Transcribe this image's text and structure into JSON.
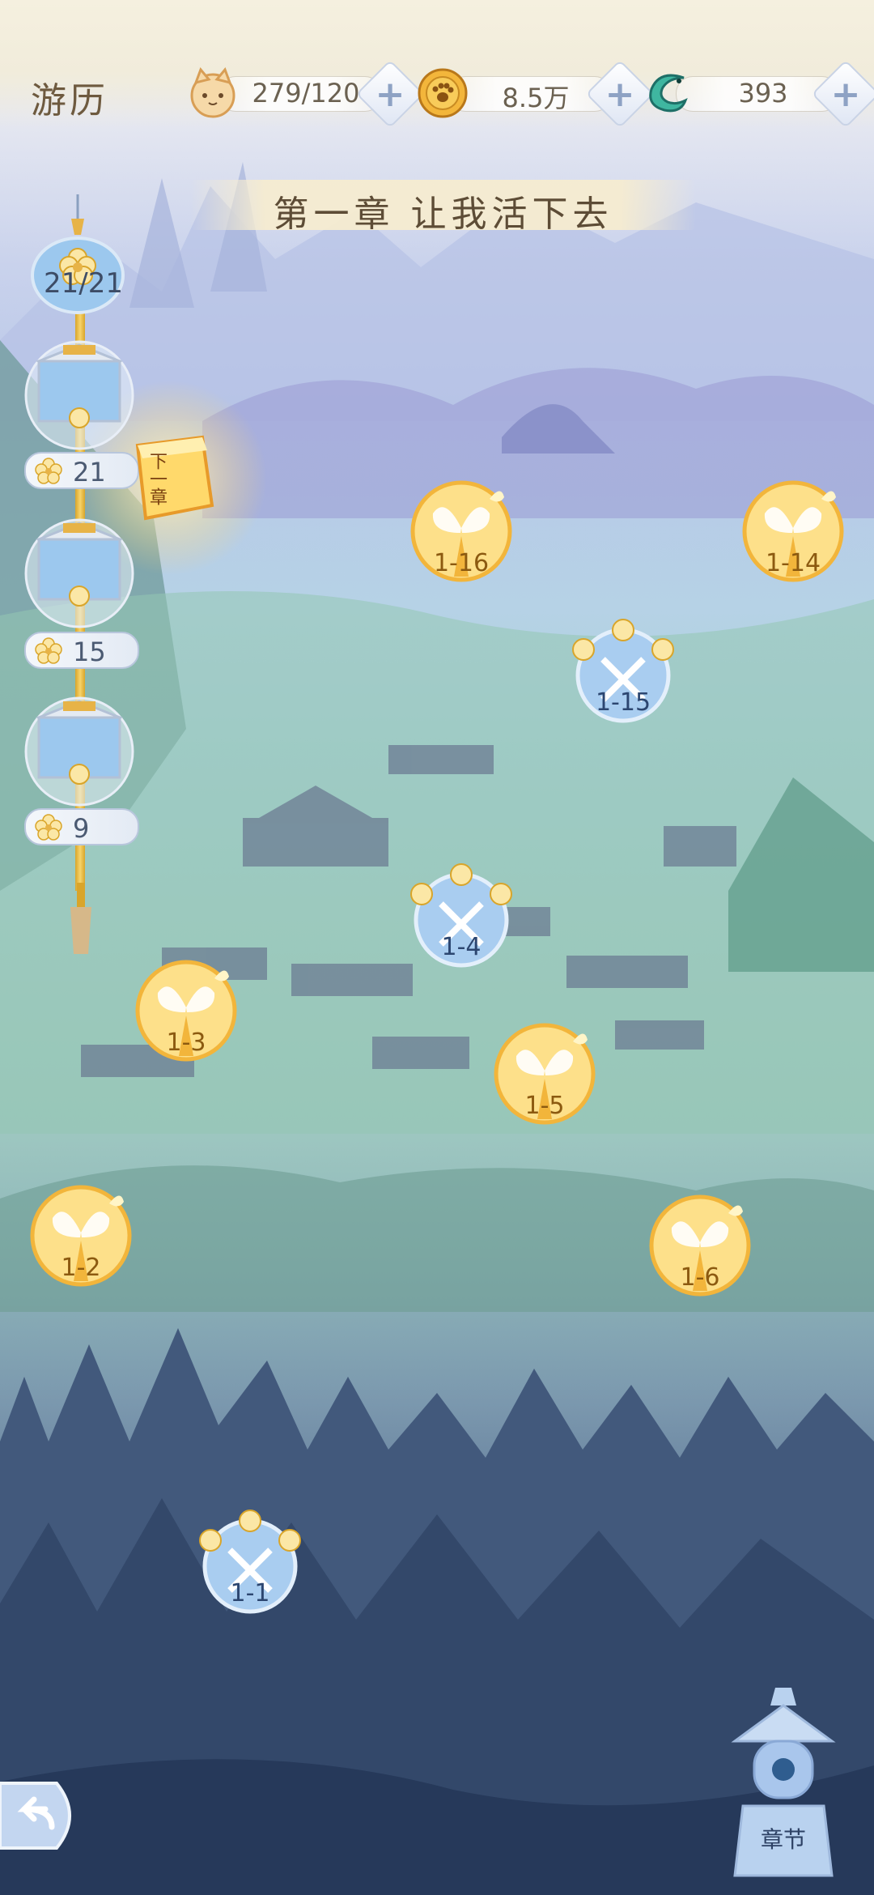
{
  "header": {
    "title": "游历",
    "resources": [
      {
        "icon": "cat-face-icon",
        "value": "279/120"
      },
      {
        "icon": "paw-coin-icon",
        "value": "8.5万"
      },
      {
        "icon": "jade-dragon-icon",
        "value": "393"
      }
    ]
  },
  "chapter": {
    "title": "第一章 让我活下去"
  },
  "rewards": {
    "progress": "21/21",
    "milestones": [
      {
        "value": "21"
      },
      {
        "value": "15"
      },
      {
        "value": "9"
      }
    ]
  },
  "next_chapter": {
    "label": "下一章"
  },
  "stages": [
    {
      "id": "1-1",
      "type": "battle"
    },
    {
      "id": "1-2",
      "type": "butterfly"
    },
    {
      "id": "1-3",
      "type": "butterfly"
    },
    {
      "id": "1-4",
      "type": "battle"
    },
    {
      "id": "1-5",
      "type": "butterfly"
    },
    {
      "id": "1-6",
      "type": "butterfly"
    },
    {
      "id": "1-14",
      "type": "butterfly"
    },
    {
      "id": "1-15",
      "type": "battle"
    },
    {
      "id": "1-16",
      "type": "butterfly"
    }
  ],
  "footer": {
    "back_icon": "back-arrow-icon",
    "chapter_label": "章节"
  },
  "colors": {
    "gold": "#f6c84a",
    "blue_node": "#a9cdf0",
    "text_brown": "#6e5a3f"
  }
}
